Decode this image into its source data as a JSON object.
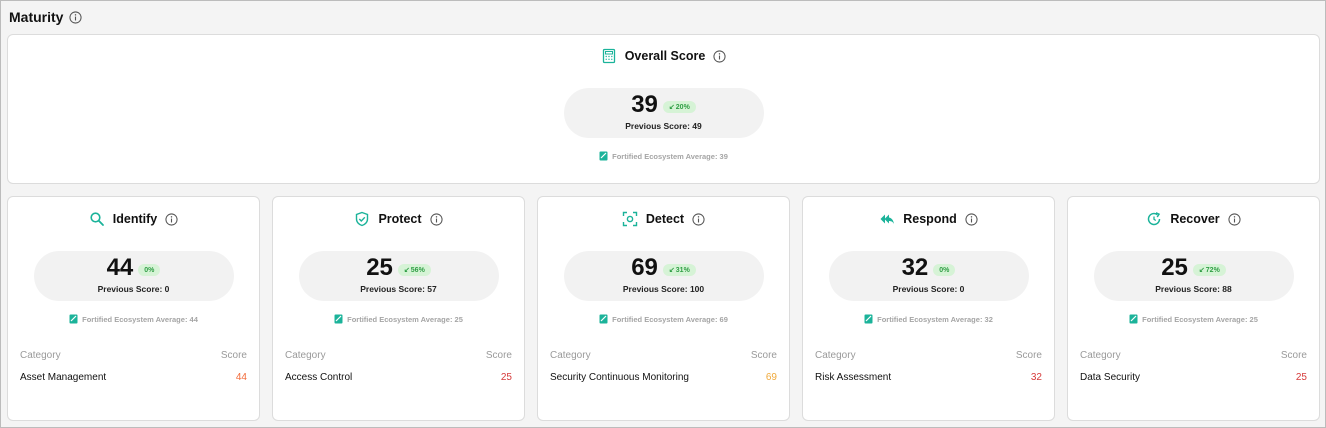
{
  "header": {
    "title": "Maturity",
    "info_icon": "info-icon"
  },
  "overall": {
    "title": "Overall Score",
    "icon": "calculator-icon",
    "score": "39",
    "change": "20%",
    "previous": "Previous Score: 49",
    "ecosystem": "Fortified Ecosystem Average: 39"
  },
  "table_headers": {
    "category": "Category",
    "score": "Score"
  },
  "cards": [
    {
      "title": "Identify",
      "icon": "search-icon",
      "score": "44",
      "change": "0%",
      "previous": "Previous Score: 0",
      "ecosystem": "Fortified Ecosystem Average: 44",
      "category": "Asset Management",
      "category_score": "44",
      "score_color": "#f26b3a"
    },
    {
      "title": "Protect",
      "icon": "shield-check-icon",
      "score": "25",
      "change": "56%",
      "previous": "Previous Score: 57",
      "ecosystem": "Fortified Ecosystem Average: 25",
      "category": "Access Control",
      "category_score": "25",
      "score_color": "#d63a3a"
    },
    {
      "title": "Detect",
      "icon": "scan-target-icon",
      "score": "69",
      "change": "31%",
      "previous": "Previous Score: 100",
      "ecosystem": "Fortified Ecosystem Average: 69",
      "category": "Security Continuous Monitoring",
      "category_score": "69",
      "score_color": "#f0a93a"
    },
    {
      "title": "Respond",
      "icon": "reply-all-icon",
      "score": "32",
      "change": "0%",
      "previous": "Previous Score: 0",
      "ecosystem": "Fortified Ecosystem Average: 32",
      "category": "Risk Assessment",
      "category_score": "32",
      "score_color": "#d63a3a"
    },
    {
      "title": "Recover",
      "icon": "refresh-clock-icon",
      "score": "25",
      "change": "72%",
      "previous": "Previous Score: 88",
      "ecosystem": "Fortified Ecosystem Average: 25",
      "category": "Data Security",
      "category_score": "25",
      "score_color": "#d63a3a"
    }
  ],
  "colors": {
    "accent": "#1bb39a",
    "badge_bg": "#d6f3d6",
    "badge_fg": "#2f9e44"
  }
}
